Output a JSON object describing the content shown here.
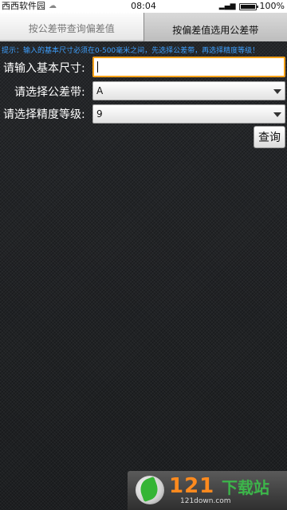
{
  "status_bar": {
    "carrier": "西西软件园",
    "time": "08:04",
    "battery": "100%",
    "battery_level": 1.0
  },
  "tabs": [
    {
      "label": "按公差带查询偏差值",
      "active": false
    },
    {
      "label": "按偏差值选用公差带",
      "active": true
    }
  ],
  "hint": "提示：输入的基本尺寸必须在0-500毫米之间，先选择公差带，再选择精度等级！",
  "form": {
    "size_label": "请输入基本尺寸:",
    "size_value": "",
    "tolerance_label": "请选择公差带:",
    "tolerance_value": "A",
    "grade_label": "请选择精度等级:",
    "grade_value": "9",
    "query_label": "查询"
  },
  "watermark": {
    "brand_a": "121",
    "brand_b": "下载站",
    "url": "121down.com"
  },
  "colors": {
    "accent": "#ffa31a",
    "hint": "#3ea0ff"
  }
}
